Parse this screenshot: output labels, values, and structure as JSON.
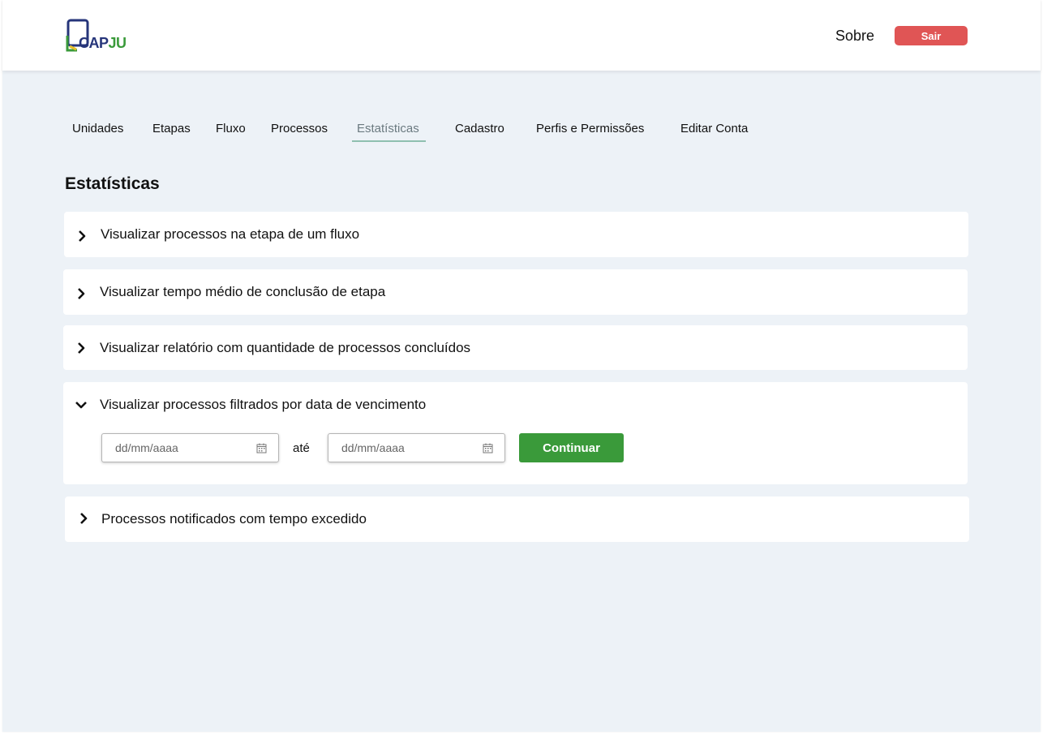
{
  "header": {
    "logo": {
      "text_cap": "CAP",
      "text_ju": "JU"
    },
    "about_label": "Sobre",
    "exit_label": "Sair"
  },
  "nav": {
    "items": [
      {
        "label": "Unidades"
      },
      {
        "label": "Etapas"
      },
      {
        "label": "Fluxo"
      },
      {
        "label": "Processos"
      },
      {
        "label": "Estatísticas",
        "active": true
      },
      {
        "label": "Cadastro"
      },
      {
        "label": "Perfis e Permissões"
      },
      {
        "label": "Editar Conta"
      }
    ]
  },
  "page": {
    "title": "Estatísticas"
  },
  "accordion": [
    {
      "label": "Visualizar processos na etapa de um fluxo",
      "expanded": false
    },
    {
      "label": "Visualizar tempo médio de conclusão de etapa",
      "expanded": false
    },
    {
      "label": "Visualizar relatório com quantidade de processos concluídos",
      "expanded": false
    },
    {
      "label": "Visualizar processos filtrados por data de vencimento",
      "expanded": true,
      "filter": {
        "start_placeholder": "dd/mm/aaaa",
        "separator": "até",
        "end_placeholder": "dd/mm/aaaa",
        "continue_label": "Continuar"
      }
    },
    {
      "label": "Processos notificados com tempo excedido",
      "expanded": false
    }
  ],
  "colors": {
    "background": "#edf2f7",
    "exit_button": "#e05555",
    "continue_button": "#3a9a3a",
    "logo_blue": "#26357a",
    "logo_green": "#3a9a3a",
    "active_underline": "#8fc0b0"
  }
}
